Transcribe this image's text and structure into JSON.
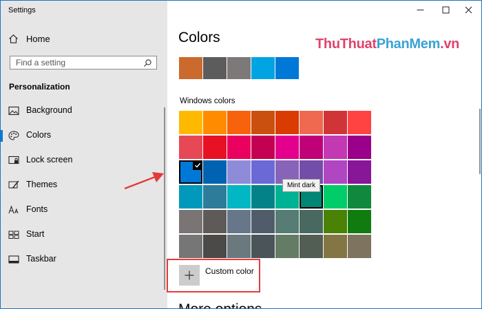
{
  "window": {
    "title": "Settings",
    "controls": {
      "minimize": "—",
      "maximize": "☐",
      "close": "✕"
    }
  },
  "sidebar": {
    "home_label": "Home",
    "search_placeholder": "Find a setting",
    "section_title": "Personalization",
    "selected_index": 1,
    "items": [
      {
        "label": "Background",
        "icon": "picture-icon"
      },
      {
        "label": "Colors",
        "icon": "palette-icon"
      },
      {
        "label": "Lock screen",
        "icon": "lock-screen-icon"
      },
      {
        "label": "Themes",
        "icon": "brush-icon"
      },
      {
        "label": "Fonts",
        "icon": "fonts-icon"
      },
      {
        "label": "Start",
        "icon": "start-grid-icon"
      },
      {
        "label": "Taskbar",
        "icon": "taskbar-icon"
      }
    ]
  },
  "main": {
    "title": "Colors",
    "watermark": {
      "part1": "ThuThuat",
      "part2": "PhanMem",
      "part3": ".vn"
    },
    "recent_colors": [
      "#CB6A2C",
      "#5C5C5C",
      "#7C7978",
      "#00A4E2",
      "#0078D7"
    ],
    "windows_colors_label": "Windows colors",
    "selected_color_index": 16,
    "hovered_color_index": 29,
    "tooltip": "Mint dark",
    "custom_color_label": "Custom color",
    "next_section_title": "More options"
  },
  "palette": [
    "#FFB900",
    "#FF8C00",
    "#F7630C",
    "#CA5010",
    "#DA3B01",
    "#EF6950",
    "#D13438",
    "#FF4343",
    "#E74856",
    "#E81123",
    "#EA005E",
    "#C30052",
    "#E3008C",
    "#BF0077",
    "#C239B3",
    "#9A0089",
    "#0078D7",
    "#0063B1",
    "#8E8CD8",
    "#6B69D6",
    "#8764B8",
    "#744DA9",
    "#B146C2",
    "#881798",
    "#0099BC",
    "#2D7D9A",
    "#00B7C3",
    "#038387",
    "#00B294",
    "#018574",
    "#00CC6A",
    "#10893E",
    "#7A7574",
    "#5D5A58",
    "#68768A",
    "#515C6B",
    "#567C73",
    "#486860",
    "#498205",
    "#107C10",
    "#767676",
    "#4C4A48",
    "#69797E",
    "#4A5459",
    "#647C64",
    "#525E54",
    "#847545",
    "#7E735F"
  ],
  "accents": {
    "selection": "#0078d7",
    "annotation": "#e53a3a",
    "window_border": "#1e73be"
  }
}
